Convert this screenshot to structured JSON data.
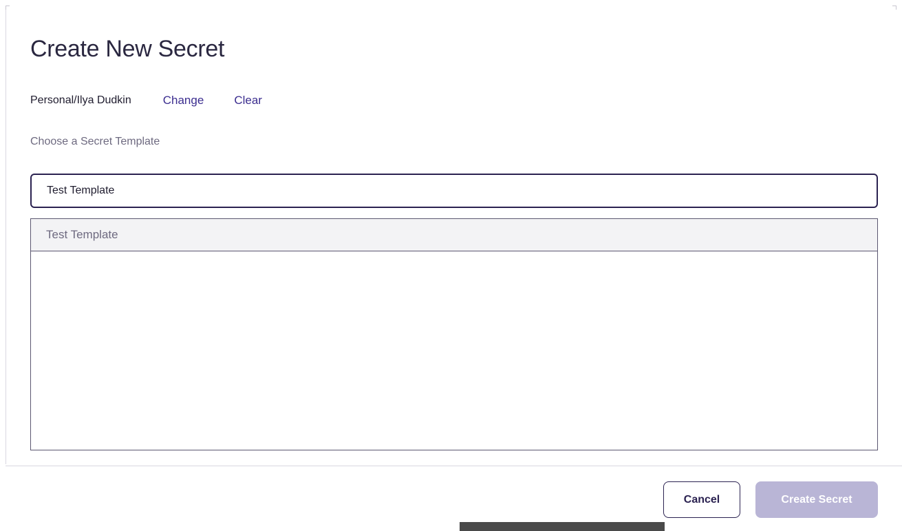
{
  "dialog": {
    "title": "Create New Secret",
    "folder": {
      "path": "Personal/Ilya Dudkin",
      "change_label": "Change",
      "clear_label": "Clear"
    },
    "template": {
      "label": "Choose a Secret Template",
      "input_value": "Test Template",
      "suggestions": [
        "Test Template"
      ]
    },
    "footer": {
      "cancel_label": "Cancel",
      "create_label": "Create Secret"
    }
  },
  "colors": {
    "accent": "#3b2d8f",
    "input_border": "#2a2150",
    "disabled_button": "#b9b5d6",
    "suggestion_bg": "#f3f3f5"
  }
}
